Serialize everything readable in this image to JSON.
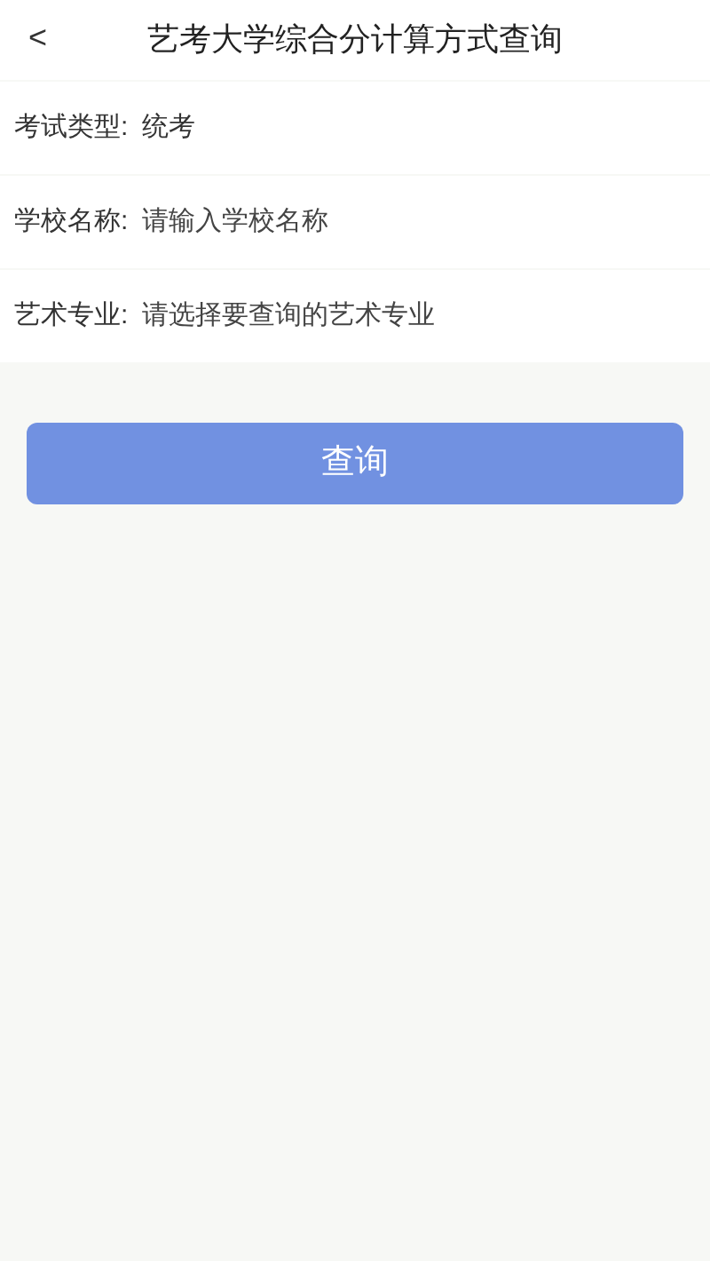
{
  "header": {
    "back": "<",
    "title": "艺考大学综合分计算方式查询"
  },
  "form": [
    {
      "kind": "text",
      "label": "考试类型:",
      "value": "统考"
    },
    {
      "kind": "input",
      "label": "学校名称:",
      "placeholder": "请输入学校名称"
    },
    {
      "kind": "select",
      "label": "艺术专业:",
      "placeholder": "请选择要查询的艺术专业"
    }
  ],
  "submit": "查询"
}
